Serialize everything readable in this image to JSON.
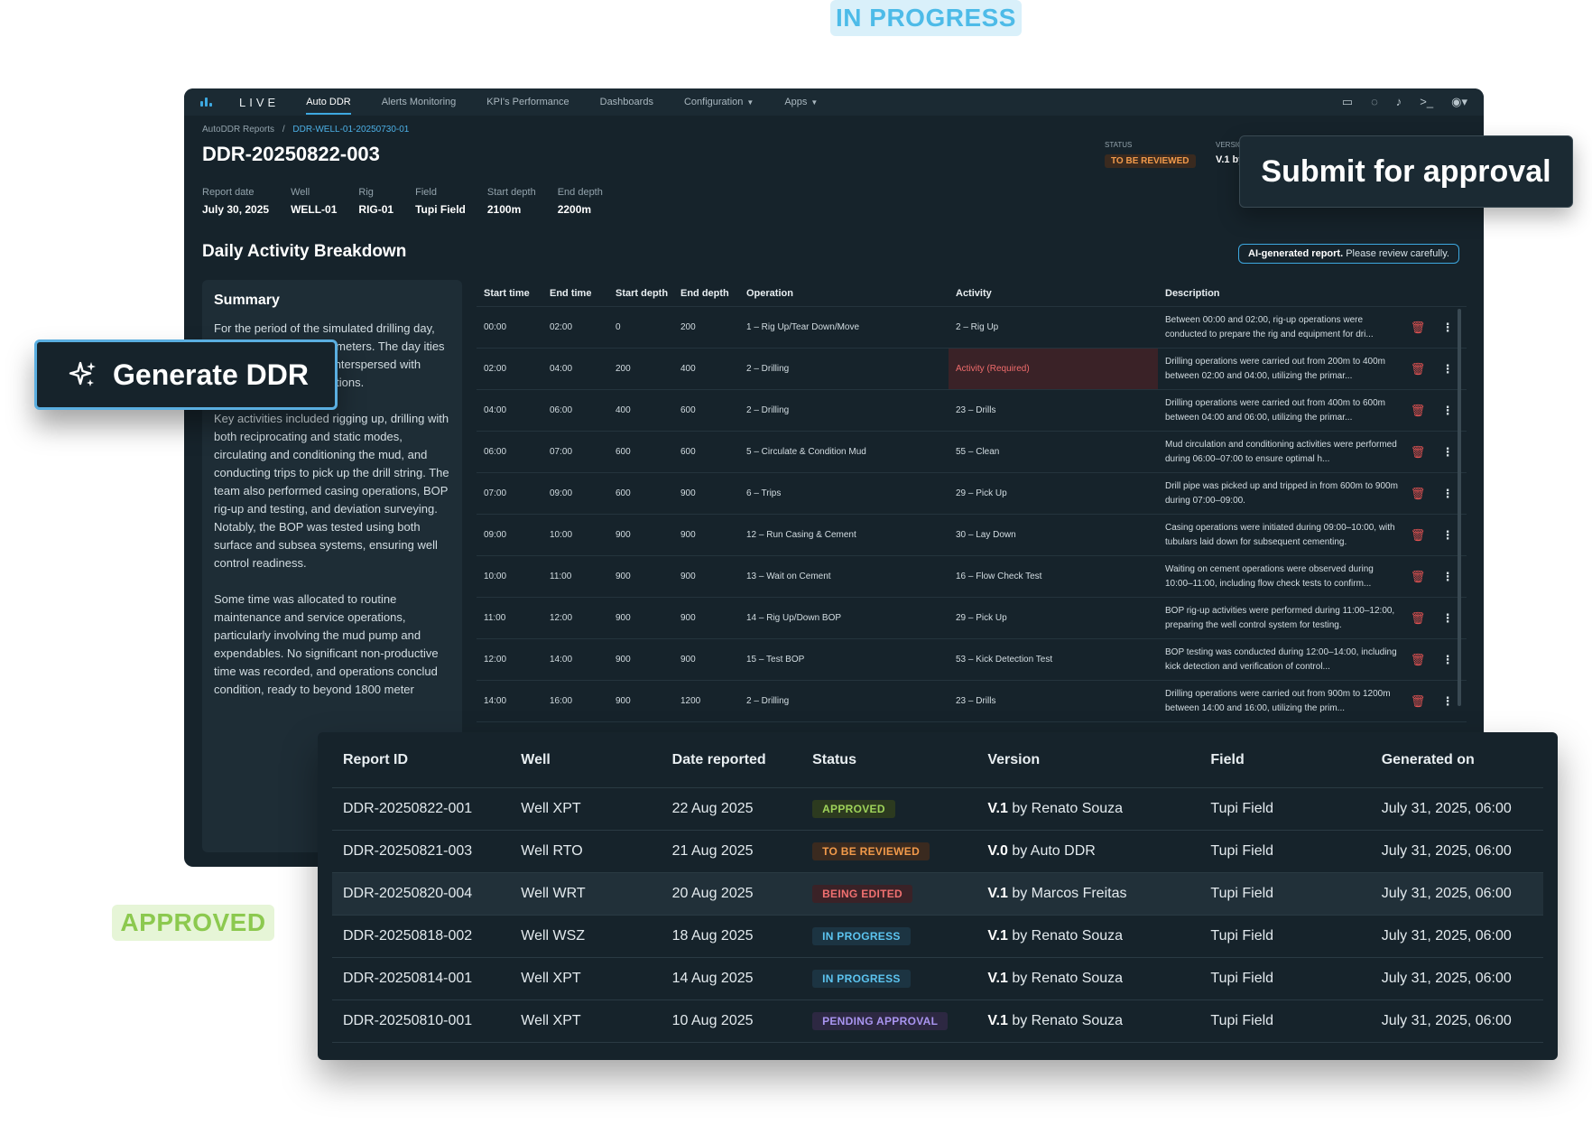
{
  "floating": {
    "in_progress": "IN PROGRESS",
    "approved": "APPROVED"
  },
  "nav": {
    "brand": "LIVE",
    "tabs": [
      "Auto DDR",
      "Alerts Monitoring",
      "KPI's Performance",
      "Dashboards",
      "Configuration",
      "Apps"
    ],
    "icons": [
      "tablet-icon",
      "chat-icon",
      "bell-icon",
      "terminal-icon",
      "user-icon"
    ]
  },
  "breadcrumb": {
    "root": "AutoDDR Reports",
    "sep": "/",
    "current": "DDR-WELL-01-20250730-01"
  },
  "report": {
    "title": "DDR-20250822-003",
    "status_label": "STATUS",
    "status": "TO BE REVIEWED",
    "version_label": "VERSIO",
    "version": "V.1 by",
    "meta": [
      {
        "k": "Report date",
        "v": "July 30, 2025"
      },
      {
        "k": "Well",
        "v": "WELL-01"
      },
      {
        "k": "Rig",
        "v": "RIG-01"
      },
      {
        "k": "Field",
        "v": "Tupi Field"
      },
      {
        "k": "Start depth",
        "v": "2100m"
      },
      {
        "k": "End depth",
        "v": "2200m"
      }
    ]
  },
  "breakdown": {
    "title": "Daily Activity Breakdown",
    "ai_note_bold": "AI-generated report.",
    "ai_note": "Please review carefully.",
    "headers": [
      "Start time",
      "End time",
      "Start depth",
      "End depth",
      "Operation",
      "Activity",
      "Description"
    ],
    "rows": [
      [
        "00:00",
        "02:00",
        "0",
        "200",
        "1 – Rig Up/Tear Down/Move",
        "2 – Rig Up",
        "Between 00:00 and 02:00, rig-up operations were conducted to prepare the rig and equipment for dri..."
      ],
      [
        "02:00",
        "04:00",
        "200",
        "400",
        "2 – Drilling",
        "Activity (Required)",
        "Drilling operations were carried out from 200m to 400m between 02:00 and 04:00, utilizing the primar..."
      ],
      [
        "04:00",
        "06:00",
        "400",
        "600",
        "2 – Drilling",
        "23 – Drills",
        "Drilling operations were carried out from 400m to 600m between 04:00 and 06:00, utilizing the primar..."
      ],
      [
        "06:00",
        "07:00",
        "600",
        "600",
        "5 – Circulate & Condition Mud",
        "55 – Clean",
        "Mud circulation and conditioning activities were performed during 06:00–07:00 to ensure optimal h..."
      ],
      [
        "07:00",
        "09:00",
        "600",
        "900",
        "6 – Trips",
        "29 – Pick Up",
        "Drill pipe was picked up and tripped in from 600m to 900m during 07:00–09:00."
      ],
      [
        "09:00",
        "10:00",
        "900",
        "900",
        "12 – Run Casing & Cement",
        "30 – Lay Down",
        "Casing operations were initiated during 09:00–10:00, with tubulars laid down for subsequent cementing."
      ],
      [
        "10:00",
        "11:00",
        "900",
        "900",
        "13 – Wait on Cement",
        "16 – Flow Check Test",
        "Waiting on cement operations were observed during 10:00–11:00, including flow check tests to confirm..."
      ],
      [
        "11:00",
        "12:00",
        "900",
        "900",
        "14 – Rig Up/Down BOP",
        "29 – Pick Up",
        "BOP rig-up activities were performed during 11:00–12:00, preparing the well control system for testing."
      ],
      [
        "12:00",
        "14:00",
        "900",
        "900",
        "15 – Test BOP",
        "53 – Kick Detection Test",
        "BOP testing was conducted during 12:00–14:00, including kick detection and verification of control..."
      ],
      [
        "14:00",
        "16:00",
        "900",
        "1200",
        "2 – Drilling",
        "23 – Drills",
        "Drilling operations were carried out from 900m to 1200m between 14:00 and 16:00, utilizing the prim..."
      ]
    ]
  },
  "summary": {
    "title": "Summary",
    "paragraphs": [
      "For the period of the simulated drilling day, steadily on the well, 00 meters. The day ities and continued tervals, interspersed with essential support operations.",
      "Key activities included rigging up, drilling with both reciprocating and static modes, circulating and conditioning the mud, and conducting trips to pick up the drill string. The team also performed casing operations, BOP rig-up and testing, and deviation surveying. Notably, the BOP was tested using both surface and subsea systems, ensuring well control readiness.",
      "Some time was allocated to routine maintenance and service operations, particularly involving the mud pump and expendables. No significant non-productive time was recorded, and operations conclud condition, ready to beyond 1800 meter"
    ]
  },
  "callouts": {
    "generate": "Generate DDR",
    "submit": "Submit for approval"
  },
  "reports": {
    "headers": [
      "Report ID",
      "Well",
      "Date reported",
      "Status",
      "Version",
      "Field",
      "Generated on"
    ],
    "rows": [
      {
        "id": "DDR-20250822-001",
        "well": "Well XPT",
        "date": "22 Aug 2025",
        "status": "APPROVED",
        "ver": "V.1",
        "by": "by Renato Souza",
        "field": "Tupi Field",
        "gen": "July 31, 2025, 06:00"
      },
      {
        "id": "DDR-20250821-003",
        "well": "Well RTO",
        "date": "21 Aug 2025",
        "status": "TO BE REVIEWED",
        "ver": "V.0",
        "by": "by Auto DDR",
        "field": "Tupi Field",
        "gen": "July 31, 2025, 06:00"
      },
      {
        "id": "DDR-20250820-004",
        "well": "Well WRT",
        "date": "20 Aug 2025",
        "status": "BEING EDITED",
        "ver": "V.1",
        "by": "by Marcos Freitas",
        "field": "Tupi Field",
        "gen": "July 31, 2025, 06:00"
      },
      {
        "id": "DDR-20250818-002",
        "well": "Well WSZ",
        "date": "18 Aug 2025",
        "status": "IN PROGRESS",
        "ver": "V.1",
        "by": "by Renato Souza",
        "field": "Tupi Field",
        "gen": "July 31, 2025, 06:00"
      },
      {
        "id": "DDR-20250814-001",
        "well": "Well XPT",
        "date": "14 Aug 2025",
        "status": "IN PROGRESS",
        "ver": "V.1",
        "by": "by Renato Souza",
        "field": "Tupi Field",
        "gen": "July 31, 2025, 06:00"
      },
      {
        "id": "DDR-20250810-001",
        "well": "Well XPT",
        "date": "10 Aug 2025",
        "status": "PENDING APPROVAL",
        "ver": "V.1",
        "by": "by Renato Souza",
        "field": "Tupi Field",
        "gen": "July 31, 2025, 06:00"
      }
    ]
  },
  "status_colors": {
    "APPROVED": {
      "bg": "#2c3a1f",
      "fg": "#9ed35a"
    },
    "TO BE REVIEWED": {
      "bg": "#3a2a1f",
      "fg": "#f29a4a"
    },
    "BEING EDITED": {
      "bg": "#3a2227",
      "fg": "#f07070"
    },
    "IN PROGRESS": {
      "bg": "#1c3442",
      "fg": "#5cc4f0"
    },
    "PENDING APPROVAL": {
      "bg": "#2d2842",
      "fg": "#a995f0"
    }
  }
}
